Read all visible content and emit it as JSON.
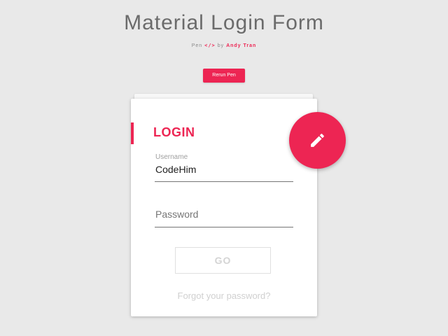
{
  "header": {
    "title": "Material Login Form",
    "byline_prefix": "Pen",
    "byline_code_icon": "</>",
    "byline_by": "by",
    "author": "Andy Tran"
  },
  "rerun_button": {
    "label": "Rerun Pen"
  },
  "login_card": {
    "title": "LOGIN",
    "username": {
      "label": "Username",
      "value": "CodeHim"
    },
    "password": {
      "placeholder": "Password"
    },
    "go_label": "GO",
    "forgot_link": "Forgot your password?"
  },
  "fab": {
    "icon": "pencil-icon"
  },
  "colors": {
    "accent": "#ed2553",
    "background": "#e9e9e9",
    "card": "#ffffff"
  }
}
